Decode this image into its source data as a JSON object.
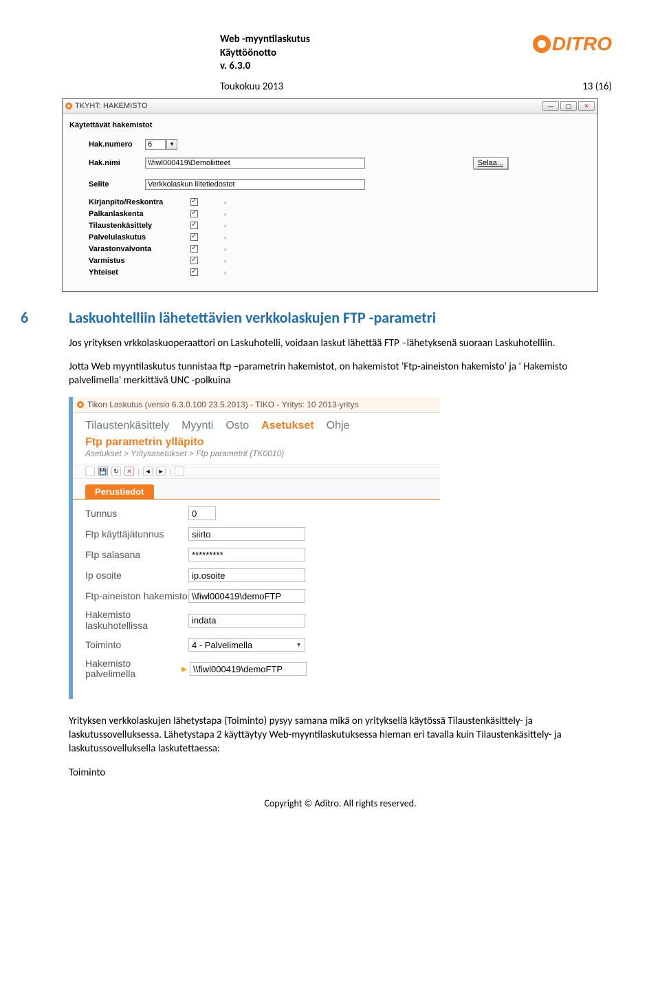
{
  "header": {
    "title_line1": "Web -myyntilaskutus",
    "title_line2": "Käyttöönotto",
    "title_line3": "v. 6.3.0",
    "logo_text": "DITRO",
    "date": "Toukokuu 2013",
    "page": "13 (16)"
  },
  "win1": {
    "title": "TKYHT: HAKEMISTO",
    "section": "Käytettävät hakemistot",
    "labels": {
      "hak_numero": "Hak.numero",
      "hak_nimi": "Hak.nimi",
      "selite": "Selite"
    },
    "hak_numero_value": "6",
    "hak_nimi_value": "\\\\fiwl000419\\Demoliitteet",
    "selite_value": "Verkkolaskun liitetiedostot",
    "browse": "Selaa...",
    "checklist": [
      "Kirjanpito/Reskontra",
      "Palkanlaskenta",
      "Tilaustenkäsittely",
      "Palvelulaskutus",
      "Varastonvalvonta",
      "Varmistus",
      "Yhteiset"
    ]
  },
  "section6": {
    "num": "6",
    "title": "Laskuohtelliin lähetettävien verkkolaskujen FTP -parametri",
    "para1": "Jos yrityksen vrkkolaskuoperaattori on Laskuhotelli, voidaan laskut lähettää FTP –lähetyksenä suoraan Laskuhotelliin.",
    "para2": "Jotta Web myyntilaskutus tunnistaa ftp –parametrin hakemistot, on hakemistot 'Ftp-aineiston hakemisto' ja ' Hakemisto palvelimella'  merkittävä UNC -polkuina"
  },
  "win2": {
    "title": "Tikon Laskutus (versio 6.3.0.100 23.5.2013) - TIKO - Yritys: 10 2013-yritys",
    "menu": [
      "Tilaustenkäsittely",
      "Myynti",
      "Osto",
      "Asetukset",
      "Ohje"
    ],
    "menu_active_index": 3,
    "subtitle": "Ftp parametrin ylläpito",
    "breadcrumb": "Asetukset > Yritysasetukset > Ftp parametrit  (TK0010)",
    "tab": "Perustiedot",
    "fields": {
      "tunnus": {
        "label": "Tunnus",
        "value": "0"
      },
      "ftp_user": {
        "label": "Ftp käyttäjätunnus",
        "value": "siirto"
      },
      "ftp_pass": {
        "label": "Ftp salasana",
        "value": "*********"
      },
      "ip": {
        "label": "Ip osoite",
        "value": "ip.osoite"
      },
      "ftp_dir": {
        "label": "Ftp-aineiston hakemisto",
        "value": "\\\\fiwl000419\\demoFTP"
      },
      "hotel_dir": {
        "label": "Hakemisto laskuhotellissa",
        "value": "indata"
      },
      "toiminto": {
        "label": "Toiminto",
        "value": "4 - Palvelimella"
      },
      "server_dir": {
        "label": "Hakemisto palvelimella",
        "value": "\\\\fiwl000419\\demoFTP"
      }
    }
  },
  "after_text": {
    "p1": "Yrityksen verkkolaskujen lähetystapa (Toiminto) pysyy  samana mikä on yrityksellä käytössä Tilaustenkäsittely- ja laskutussovelluksessa. Lähetystapa 2 käyttäytyy Web-myyntilaskutuksessa hieman eri tavalla kuin Tilaustenkäsittely- ja laskutussovelluksella laskutettaessa:",
    "p2": "Toiminto"
  },
  "footer": "Copyright © Aditro. All rights reserved."
}
